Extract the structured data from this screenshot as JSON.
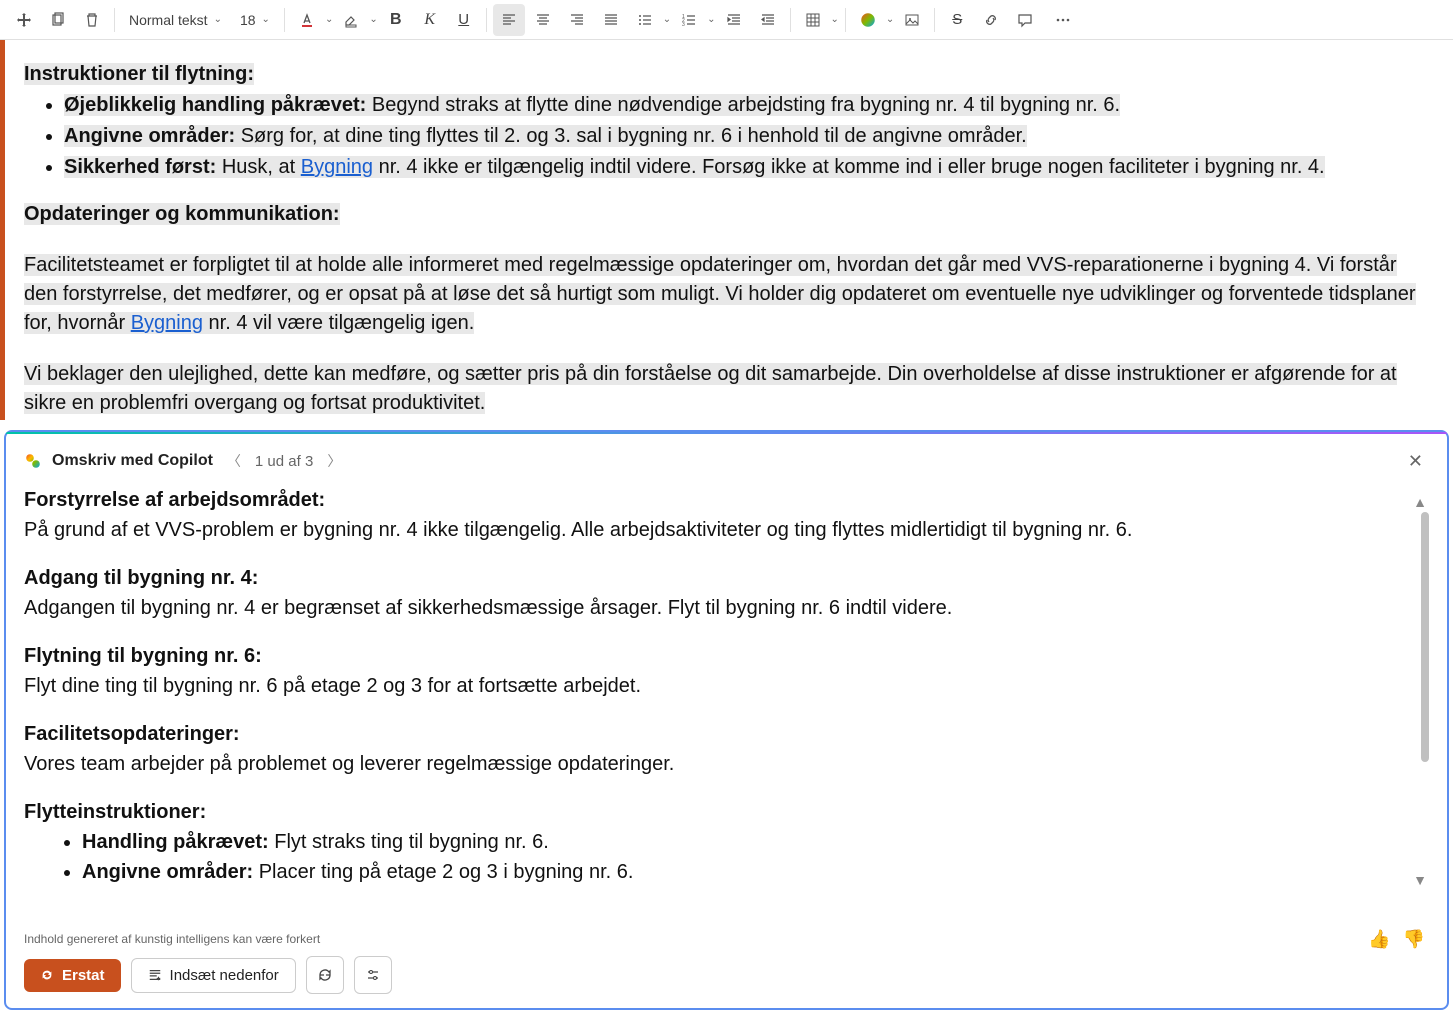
{
  "toolbar": {
    "style_label": "Normal tekst",
    "font_size": "18"
  },
  "doc": {
    "h1": "Instruktioner til flytning:",
    "li1_b": "Øjeblikkelig handling påkrævet:",
    "li1_t": " Begynd straks at flytte dine nødvendige arbejdsting fra bygning nr. 4 til bygning nr. 6.",
    "li2_b": "Angivne områder:",
    "li2_t": " Sørg for, at dine ting flyttes til 2. og 3. sal i bygning nr. 6 i henhold til de angivne områder.",
    "li3_b": "Sikkerhed først:",
    "li3_t1": " Husk, at ",
    "li3_link": "Bygning",
    "li3_t2": " nr. 4 ikke er tilgængelig indtil videre. Forsøg ikke at komme ind i eller bruge nogen faciliteter i bygning nr. 4.",
    "h2": "Opdateringer og kommunikation:",
    "p1a": "Facilitetsteamet er forpligtet til at holde alle informeret med regelmæssige opdateringer om, hvordan det går med VVS-reparationerne i bygning 4. Vi forstår den forstyrrelse, det medfører, og er opsat på at løse det så hurtigt som muligt. Vi holder dig opdateret om eventuelle nye udviklinger og forventede tidsplaner for, hvornår ",
    "p1link": "Bygning",
    "p1b": " nr. 4 vil være tilgængelig igen.",
    "p2": "Vi beklager den ulejlighed, dette kan medføre, og sætter pris på din forståelse og dit samarbejde. Din overholdelse af disse instruktioner er afgørende for at sikre en problemfri overgang og fortsat produktivitet."
  },
  "copilot": {
    "title": "Omskriv med Copilot",
    "counter": "1 ud af 3",
    "s1h": "Forstyrrelse af arbejdsområdet:",
    "s1t": "På grund af et VVS-problem er bygning nr. 4 ikke tilgængelig. Alle arbejdsaktiviteter og ting flyttes midlertidigt til bygning nr. 6.",
    "s2h": "Adgang til bygning nr. 4:",
    "s2t": "Adgangen til bygning nr. 4 er begrænset af sikkerhedsmæssige årsager. Flyt til bygning nr. 6 indtil videre.",
    "s3h": "Flytning til bygning nr. 6:",
    "s3t": "Flyt dine ting til bygning nr. 6 på etage 2 og 3 for at fortsætte arbejdet.",
    "s4h": "Facilitetsopdateringer:",
    "s4t": "Vores team arbejder på problemet og leverer regelmæssige opdateringer.",
    "s5h": "Flytteinstruktioner:",
    "s5li1b": "Handling påkrævet:",
    "s5li1t": " Flyt straks ting til bygning nr. 6.",
    "s5li2b": "Angivne områder:",
    "s5li2t": " Placer ting på etage 2 og 3 i bygning nr. 6.",
    "disclaimer": "Indhold genereret af kunstig intelligens kan være forkert",
    "replace_label": "Erstat",
    "insert_label": "Indsæt nedenfor"
  }
}
